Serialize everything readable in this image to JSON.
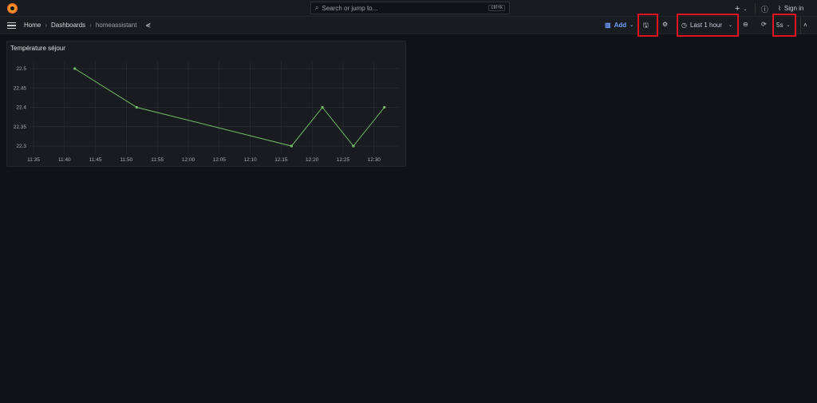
{
  "topbar": {
    "search_placeholder": "Search or jump to...",
    "shortcut": "ctrl+k",
    "plus": "+",
    "sign_in": "Sign in"
  },
  "breadcrumb": [
    "Home",
    "Dashboards",
    "homeassistant"
  ],
  "toolbar": {
    "add": "Add",
    "time_range": "Last 1 hour",
    "refresh_interval": "5s"
  },
  "panel": {
    "title": "Température séjour"
  },
  "chart_data": {
    "type": "line",
    "title": "Température séjour",
    "x_ticks": [
      "11:35",
      "11:40",
      "11:45",
      "11:50",
      "11:55",
      "12:00",
      "12:05",
      "12:10",
      "12:15",
      "12:20",
      "12:25",
      "12:30"
    ],
    "y_ticks": [
      "22.3",
      "22.35",
      "22.4",
      "22.45",
      "22.5"
    ],
    "ylim": [
      22.3,
      22.5
    ],
    "grid": true,
    "series_color": "#73bf69",
    "points": [
      {
        "x": "11:41:40",
        "y": 22.5
      },
      {
        "x": "11:51:40",
        "y": 22.4
      },
      {
        "x": "12:16:40",
        "y": 22.3
      },
      {
        "x": "12:21:40",
        "y": 22.4
      },
      {
        "x": "12:26:40",
        "y": 22.3
      },
      {
        "x": "12:31:40",
        "y": 22.4
      }
    ]
  },
  "highlight_color": "#e0141e"
}
